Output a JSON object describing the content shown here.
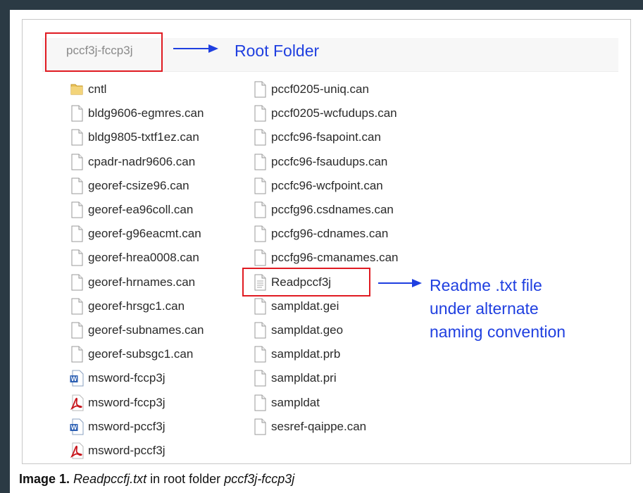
{
  "root": {
    "folder_name": "pccf3j-fccp3j",
    "annotation": "Root Folder"
  },
  "readme_note": {
    "lines": [
      "Readme .txt file",
      "under alternate",
      "naming convention"
    ]
  },
  "left_files": [
    {
      "name": "cntl",
      "icon": "folder-icon"
    },
    {
      "name": "bldg9606-egmres.can",
      "icon": "document-icon"
    },
    {
      "name": "bldg9805-txtf1ez.can",
      "icon": "document-icon"
    },
    {
      "name": "cpadr-nadr9606.can",
      "icon": "document-icon"
    },
    {
      "name": "georef-csize96.can",
      "icon": "document-icon"
    },
    {
      "name": "georef-ea96coll.can",
      "icon": "document-icon"
    },
    {
      "name": "georef-g96eacmt.can",
      "icon": "document-icon"
    },
    {
      "name": "georef-hrea0008.can",
      "icon": "document-icon"
    },
    {
      "name": "georef-hrnames.can",
      "icon": "document-icon"
    },
    {
      "name": "georef-hrsgc1.can",
      "icon": "document-icon"
    },
    {
      "name": "georef-subnames.can",
      "icon": "document-icon"
    },
    {
      "name": "georef-subsgc1.can",
      "icon": "document-icon"
    },
    {
      "name": "msword-fccp3j",
      "icon": "word-doc-icon"
    },
    {
      "name": "msword-fccp3j",
      "icon": "pdf-icon"
    },
    {
      "name": "msword-pccf3j",
      "icon": "word-doc-icon"
    },
    {
      "name": "msword-pccf3j",
      "icon": "pdf-icon"
    }
  ],
  "right_files": [
    {
      "name": "pccf0205-uniq.can",
      "icon": "document-icon"
    },
    {
      "name": "pccf0205-wcfudups.can",
      "icon": "document-icon"
    },
    {
      "name": "pccfc96-fsapoint.can",
      "icon": "document-icon"
    },
    {
      "name": "pccfc96-fsaudups.can",
      "icon": "document-icon"
    },
    {
      "name": "pccfc96-wcfpoint.can",
      "icon": "document-icon"
    },
    {
      "name": "pccfg96.csdnames.can",
      "icon": "document-icon"
    },
    {
      "name": "pccfg96-cdnames.can",
      "icon": "document-icon"
    },
    {
      "name": "pccfg96-cmanames.can",
      "icon": "document-icon"
    },
    {
      "name": "Readpccf3j",
      "icon": "text-file-icon"
    },
    {
      "name": "sampldat.gei",
      "icon": "document-icon"
    },
    {
      "name": "sampldat.geo",
      "icon": "document-icon"
    },
    {
      "name": "sampldat.prb",
      "icon": "document-icon"
    },
    {
      "name": "sampldat.pri",
      "icon": "document-icon"
    },
    {
      "name": "sampldat",
      "icon": "document-icon"
    },
    {
      "name": "sesref-qaippe.can",
      "icon": "document-icon"
    }
  ],
  "caption": {
    "label": "Image 1.",
    "file": "Readpccfj.txt",
    "middle": "in root folder",
    "folder": "pccf3j-fccp3j"
  },
  "colors": {
    "highlight_red": "#e01b22",
    "annotation_blue": "#1f3fe0",
    "outer_background": "#2b3a44"
  }
}
